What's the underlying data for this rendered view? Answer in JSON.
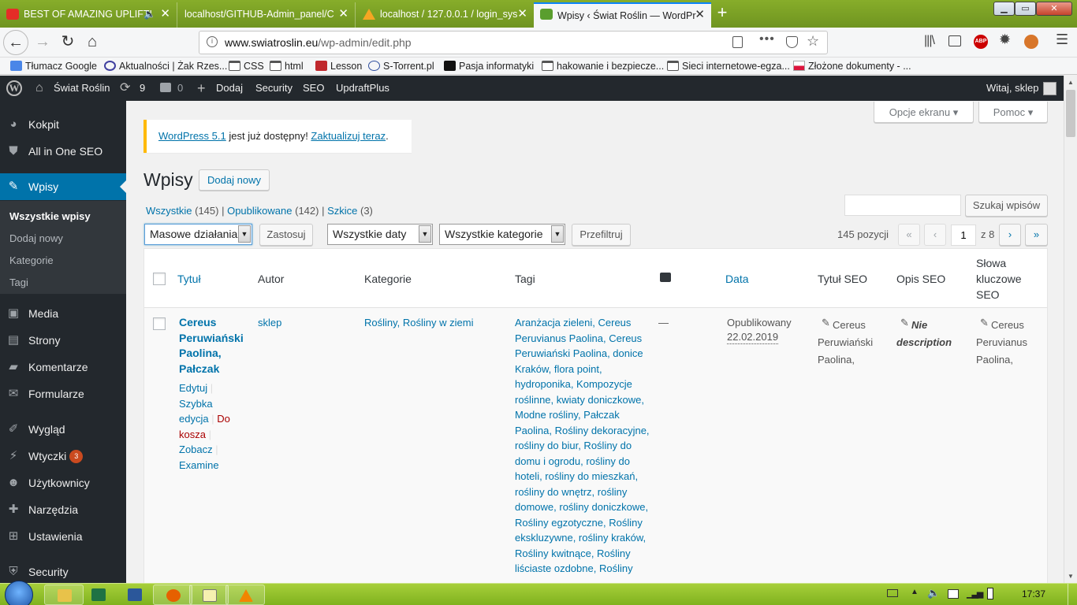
{
  "browser": {
    "tabs": [
      {
        "label": "BEST OF AMAZING UPLIFTI",
        "icon": "youtube-icon",
        "active": false
      },
      {
        "label": "localhost/GITHUB-Admin_panel/C",
        "icon": "",
        "active": false
      },
      {
        "label": "localhost / 127.0.0.1 / login_sys",
        "icon": "phpmyadmin-icon",
        "active": false
      },
      {
        "label": "Wpisy ‹ Świat Roślin — WordPr",
        "icon": "site-icon",
        "active": true
      }
    ],
    "url_host": "www.swiatroslin.eu",
    "url_path": "/wp-admin/edit.php",
    "bookmarks": [
      {
        "label": "Tłumacz Google",
        "icon": "translate-icon"
      },
      {
        "label": "Aktualności | Żak Rzes...",
        "icon": "zak-icon"
      },
      {
        "label": "CSS",
        "icon": "folder-icon"
      },
      {
        "label": "html",
        "icon": "folder-icon"
      },
      {
        "label": "Lesson",
        "icon": "lesson-icon"
      },
      {
        "label": "S-Torrent.pl",
        "icon": "torrent-icon"
      },
      {
        "label": "Pasja informatyki",
        "icon": "pasja-icon"
      },
      {
        "label": "hakowanie i bezpiecze...",
        "icon": "folder-icon"
      },
      {
        "label": "Sieci internetowe-egza...",
        "icon": "folder-icon"
      },
      {
        "label": "Złożone dokumenty - ...",
        "icon": "gov-icon"
      }
    ]
  },
  "adminbar": {
    "site": "Świat Roślin",
    "updates": "9",
    "comments": "0",
    "add": "Dodaj",
    "security": "Security",
    "seo": "SEO",
    "updraft": "UpdraftPlus",
    "greeting": "Witaj, sklep"
  },
  "sidebar": {
    "kokpit": "Kokpit",
    "aioseo": "All in One SEO",
    "wpisy": "Wpisy",
    "sub": [
      "Wszystkie wpisy",
      "Dodaj nowy",
      "Kategorie",
      "Tagi"
    ],
    "media": "Media",
    "strony": "Strony",
    "komentarze": "Komentarze",
    "formularze": "Formularze",
    "wyglad": "Wygląd",
    "wtyczki": "Wtyczki",
    "wtyczki_badge": "3",
    "uzytkownicy": "Użytkownicy",
    "narzedzia": "Narzędzia",
    "ustawienia": "Ustawienia",
    "security": "Security"
  },
  "screen": {
    "options": "Opcje ekranu",
    "help": "Pomoc",
    "notice_link1": "WordPress 5.1",
    "notice_text": " jest już dostępny! ",
    "notice_link2": "Zaktualizuj teraz",
    "notice_dot": ".",
    "title": "Wpisy",
    "add_new": "Dodaj nowy",
    "filter_all": "Wszystkie",
    "filter_all_count": "(145)",
    "filter_pub": "Opublikowane",
    "filter_pub_count": "(142)",
    "filter_draft": "Szkice",
    "filter_draft_count": "(3)",
    "search_value": "",
    "search_button": "Szukaj wpisów",
    "bulk": "Masowe działania",
    "apply": "Zastosuj",
    "dates": "Wszystkie daty",
    "cats": "Wszystkie kategorie",
    "filter_btn": "Przefiltruj",
    "items": "145 pozycji",
    "first": "«",
    "prev": "‹",
    "page": "1",
    "of": "z 8",
    "next": "›",
    "last": "»"
  },
  "table": {
    "headers": [
      "Tytuł",
      "Autor",
      "Kategorie",
      "Tagi",
      "",
      "Data",
      "Tytuł SEO",
      "Opis SEO",
      "Słowa kluczowe SEO"
    ],
    "row": {
      "title": "Cereus Peruwiański Paolina, Pałczak",
      "actions": [
        "Edytuj",
        "Szybka edycja",
        "Do kosza",
        "Zobacz",
        "Examine"
      ],
      "author": "sklep",
      "categories": "Rośliny, Rośliny w ziemi",
      "tags": "Aranżacja zieleni, Cereus Peruvianus Paolina, Cereus Peruwiański Paolina, donice Kraków, flora point, hydroponika, Kompozycje roślinne, kwiaty doniczkowe, Modne rośliny, Pałczak Paolina, Rośliny dekoracyjne, rośliny do biur, Rośliny do domu i ogrodu, rośliny do hoteli, rośliny do mieszkań, rośliny do wnętrz, rośliny domowe, rośliny doniczkowe, Rośliny egzotyczne, Rośliny ekskluzywne, rośliny kraków, Rośliny kwitnące, Rośliny liściaste ozdobne, Rośliny",
      "comments": "—",
      "date_status": "Opublikowany",
      "date": "22.02.2019",
      "seo_title": "Cereus Peruwiański Paolina, Pałczak",
      "seo_desc": "Nie description",
      "seo_keywords": "Cereus Peruvianus Paolina, Cereus"
    }
  },
  "taskbar": {
    "time": "17:37"
  }
}
